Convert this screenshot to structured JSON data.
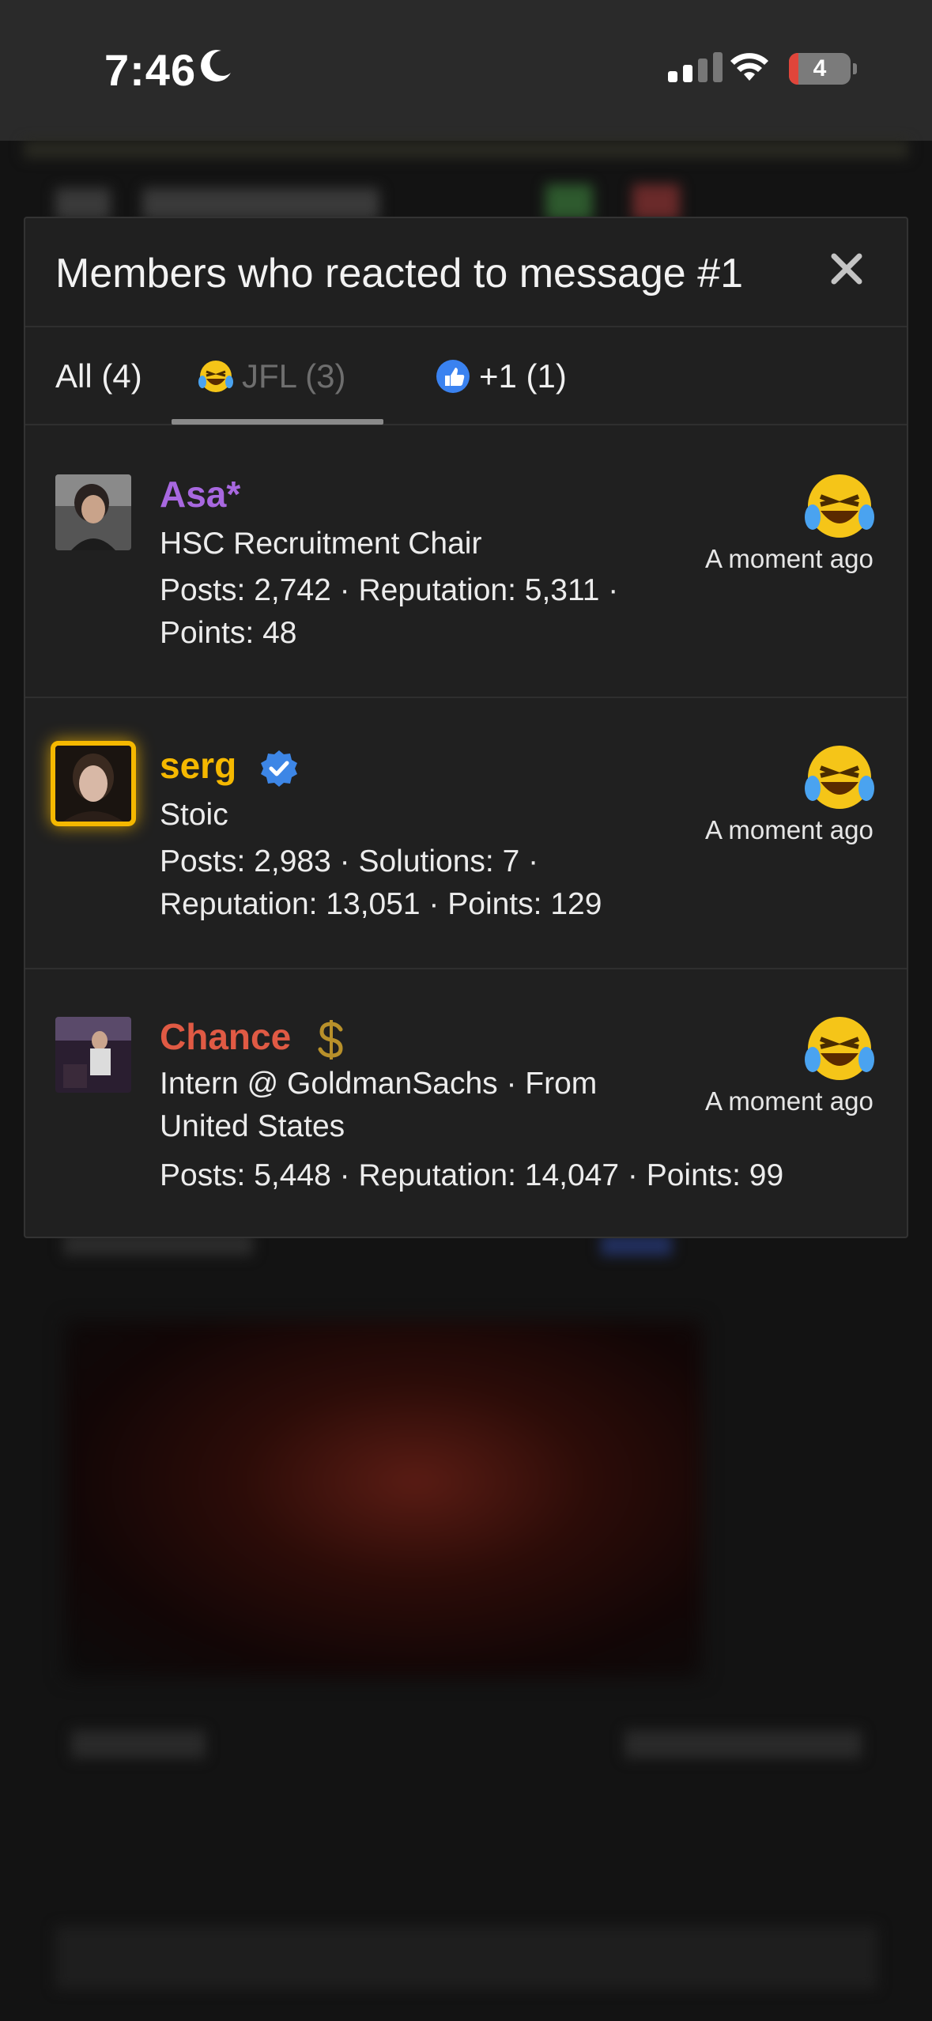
{
  "status": {
    "time": "7:46",
    "battery": "4"
  },
  "modal": {
    "title": "Members who reacted to message #1",
    "close_label": "×",
    "tabs": [
      {
        "label": "All (4)",
        "active": false
      },
      {
        "label": "JFL (3)",
        "active": true,
        "icon": "laughing-crying-emoji-icon"
      },
      {
        "label": "+1 (1)",
        "active": false,
        "icon": "thumbs-up-icon"
      }
    ],
    "members": [
      {
        "name": "Asa*",
        "name_color": "#a868e0",
        "title": "HSC Recruitment Chair",
        "stats_line1": "Posts: 2,742 · Reputation: 5,311 ·",
        "stats_line2": "Points: 48",
        "time": "A moment ago"
      },
      {
        "name": "serg",
        "name_color": "#f5b800",
        "badge": "verified-check-icon",
        "title": "Stoic",
        "stats_line1": "Posts: 2,983 · Solutions: 7 ·",
        "stats_line2": "Reputation: 13,051 · Points: 129",
        "time": "A moment ago"
      },
      {
        "name": "Chance",
        "name_color": "#e05a44",
        "badge": "dollar-icon",
        "title_line1": "Intern @ GoldmanSachs · From",
        "title_line2": "United States",
        "stats_line1": "Posts: 5,448 · Reputation: 14,047 · Points: 99",
        "time": "A moment ago"
      }
    ]
  }
}
